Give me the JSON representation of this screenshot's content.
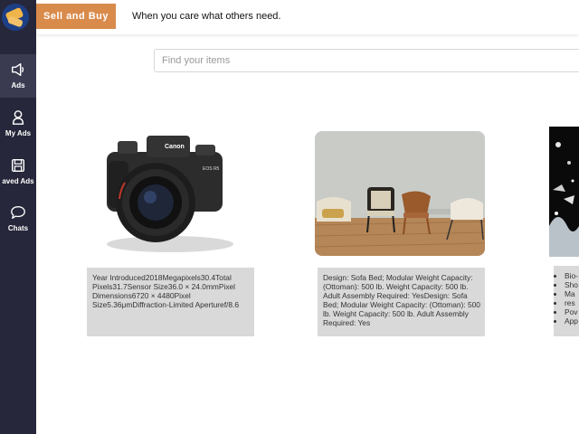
{
  "header": {
    "brand": "Sell and Buy",
    "tagline": "When you care what others need."
  },
  "search": {
    "placeholder": "Find your items"
  },
  "sidebar": {
    "items": [
      {
        "label": "Ads",
        "icon": "megaphone-icon"
      },
      {
        "label": "My Ads",
        "icon": "user-icon"
      },
      {
        "label": "aved Ads",
        "icon": "save-icon"
      },
      {
        "label": "Chats",
        "icon": "chat-bubble-icon"
      }
    ]
  },
  "listings": [
    {
      "image": "camera-photo",
      "description": "Year Introduced2018Megapixels30.4Total Pixels31.7Sensor Size36.0 × 24.0mmPixel Dimensions6720 × 4480Pixel Size5.36μmDiffraction-Limited Aperturef/8.6"
    },
    {
      "image": "chairs-room-photo",
      "description": "Design: Sofa Bed; Modular Weight Capacity: (Ottoman): 500 lb. Weight Capacity: 500 lb. Adult Assembly Required: YesDesign: Sofa Bed; Modular Weight Capacity: (Ottoman): 500 lb. Weight Capacity: 500 lb. Adult Assembly Required: Yes"
    },
    {
      "image": "splash-photo",
      "bullets": [
        "Bio-",
        "Sho",
        "Ma",
        "res",
        "Pov",
        "App"
      ]
    }
  ],
  "colors": {
    "sidebar": "#26273a",
    "brand": "#d98b4b",
    "description_bg": "#d9d9d9"
  }
}
